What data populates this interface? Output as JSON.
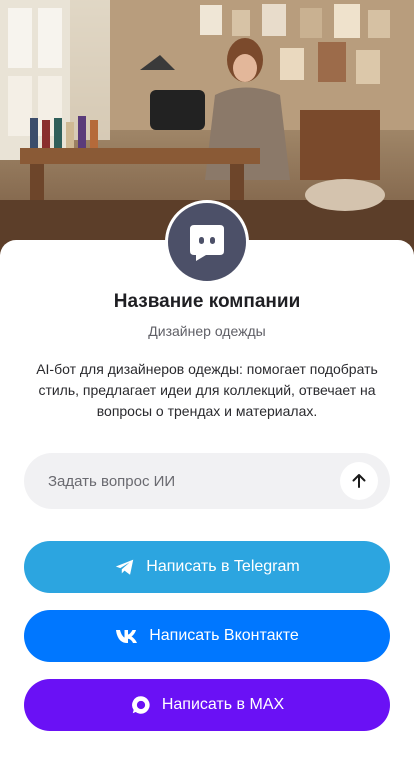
{
  "company": {
    "name": "Название компании",
    "subtitle": "Дизайнер одежды",
    "description": "AI-бот для дизайнеров одежды: помогает подобрать стиль, предлагает идеи для коллекций, отвечает на вопросы о трендах и материалах."
  },
  "ask": {
    "placeholder": "Задать вопрос ИИ"
  },
  "buttons": {
    "telegram": "Написать в Telegram",
    "vk": "Написать Вконтакте",
    "max": "Написать в MAX"
  },
  "colors": {
    "telegram": "#2ca5e0",
    "vk": "#0077ff",
    "max": "#6a11f5",
    "avatar": "#4c5068"
  },
  "icons": {
    "avatar": "chat-bubble-icon",
    "send": "arrow-up-icon",
    "telegram": "telegram-icon",
    "vk": "vk-icon",
    "max": "max-icon"
  }
}
